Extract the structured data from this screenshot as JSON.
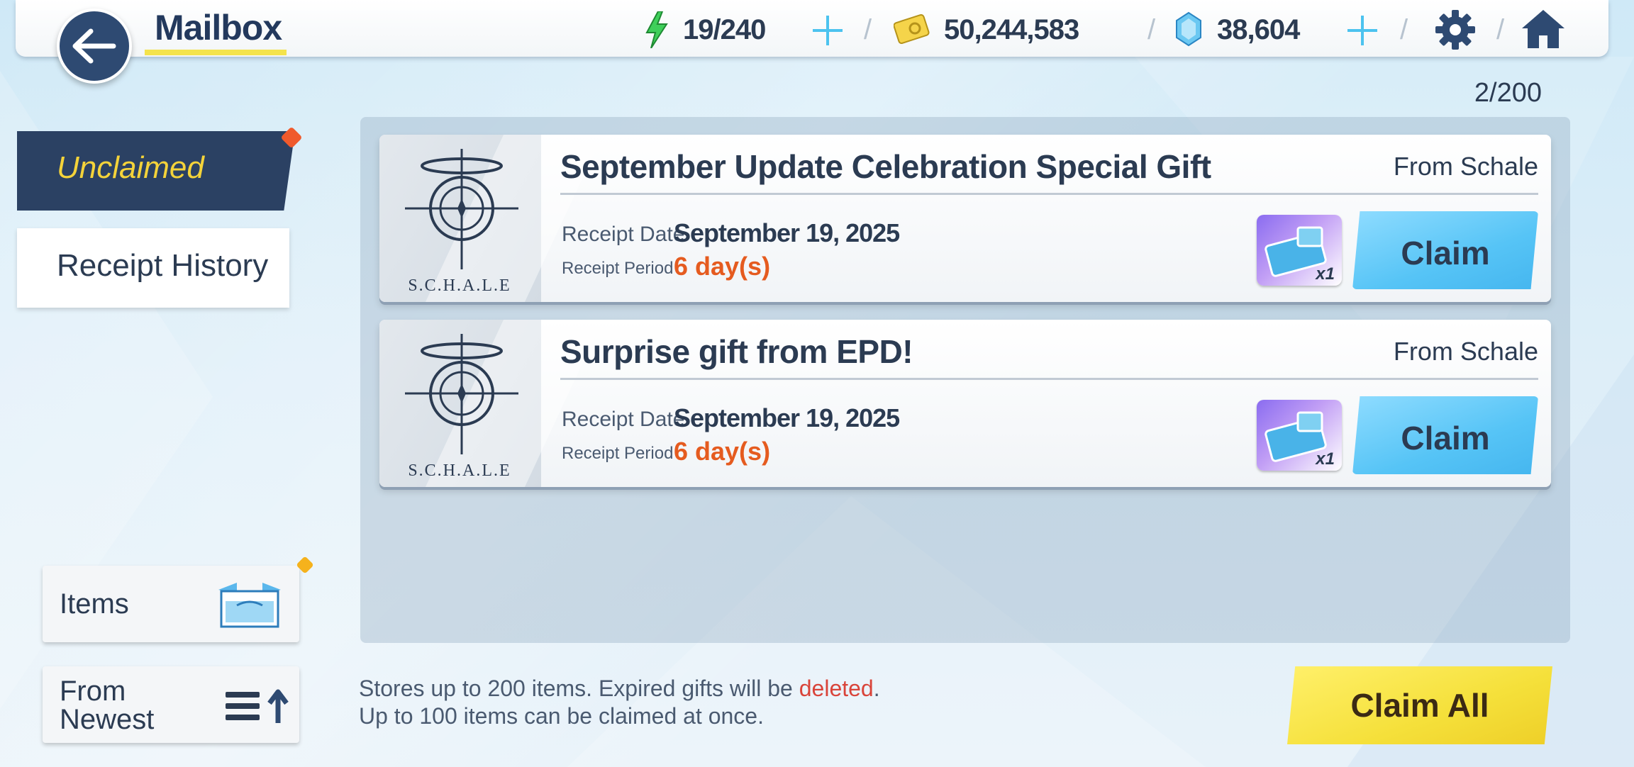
{
  "header": {
    "title": "Mailbox",
    "ap": "19/240",
    "credits": "50,244,583",
    "pyroxene": "38,604"
  },
  "mail_count": "2/200",
  "tabs": {
    "unclaimed": "Unclaimed",
    "history": "Receipt History"
  },
  "filter": {
    "items_label": "Items",
    "sort_line1": "From",
    "sort_line2": "Newest"
  },
  "mails": [
    {
      "title": "September Update Celebration Special Gift",
      "from": "From Schale",
      "date_label": "Receipt Date",
      "date": "September 19, 2025",
      "period_label": "Receipt Period",
      "period": "6 day(s)",
      "reward_qty": "x1",
      "claim_label": "Claim",
      "logo_text": "S.C.H.A.L.E"
    },
    {
      "title": "Surprise gift from EPD!",
      "from": "From Schale",
      "date_label": "Receipt Date",
      "date": "September 19, 2025",
      "period_label": "Receipt Period",
      "period": "6 day(s)",
      "reward_qty": "x1",
      "claim_label": "Claim",
      "logo_text": "S.C.H.A.L.E"
    }
  ],
  "notes": {
    "line1_a": "Stores up to 200 items. Expired gifts will be ",
    "line1_b": "deleted",
    "line1_c": ".",
    "line2": "Up to 100 items can be claimed at once."
  },
  "claim_all_label": "Claim All",
  "colors": {
    "navy": "#2b4163",
    "accent_yellow": "#f4d33a",
    "claim_blue": "#56c4f6",
    "period_orange": "#e55b1f",
    "deleted_red": "#d9443a"
  }
}
